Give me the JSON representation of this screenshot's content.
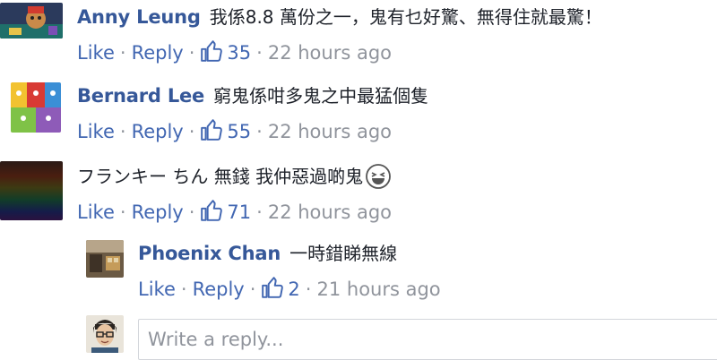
{
  "comments": [
    {
      "author": "Anny Leung",
      "text": "我係8.8 萬份之一，鬼有乜好驚、無得住就最驚！",
      "like_label": "Like",
      "reply_label": "Reply",
      "likes": "35",
      "time": "22 hours ago",
      "separator": "·"
    },
    {
      "author": "Bernard Lee",
      "text": "窮鬼係咁多鬼之中最猛個隻",
      "like_label": "Like",
      "reply_label": "Reply",
      "likes": "55",
      "time": "22 hours ago",
      "separator": "·"
    },
    {
      "author": "",
      "text": "フランキー ちん 無錢 我仲惡過啲鬼",
      "like_label": "Like",
      "reply_label": "Reply",
      "likes": "71",
      "time": "22 hours ago",
      "separator": "·"
    },
    {
      "author": "Phoenix Chan",
      "text": "一時錯睇無線",
      "like_label": "Like",
      "reply_label": "Reply",
      "likes": "2",
      "time": "21 hours ago",
      "separator": "·"
    }
  ],
  "reply_box": {
    "placeholder": "Write a reply..."
  },
  "colors": {
    "author": "#365899",
    "link": "#4267b2",
    "meta": "#90949c",
    "text": "#1d2129"
  },
  "icons": {
    "like": "thumbs-up-icon",
    "emoji": "laughing-emoji-icon"
  }
}
